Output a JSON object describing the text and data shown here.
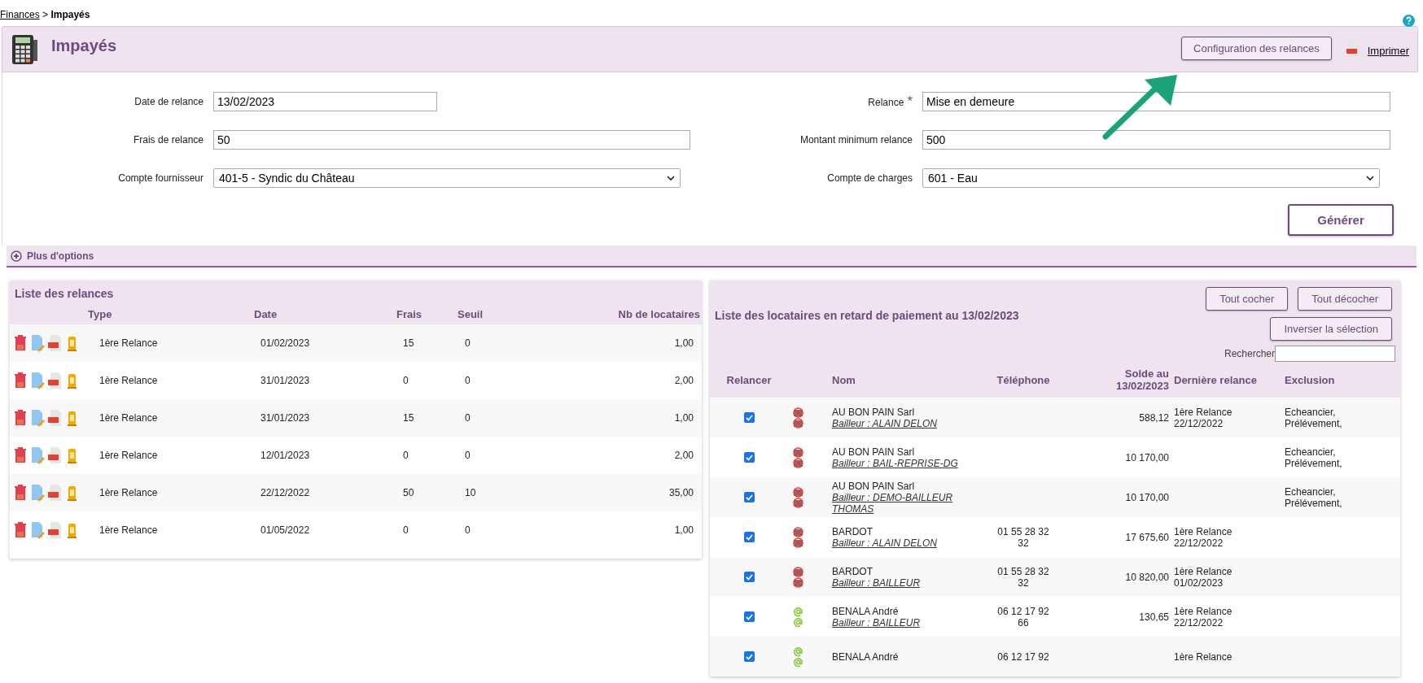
{
  "breadcrumb": {
    "parent": "Finances",
    "separator": ">",
    "current": "Impayés"
  },
  "header": {
    "title": "Impayés",
    "config_button": "Configuration des relances",
    "print_link": "Imprimer"
  },
  "form": {
    "left": [
      {
        "label": "Date de relance",
        "value": "13/02/2023",
        "kind": "text"
      },
      {
        "label": "Frais de relance",
        "value": "50",
        "kind": "text"
      },
      {
        "label": "Compte fournisseur",
        "value": "401-5 - Syndic du Château",
        "kind": "select"
      }
    ],
    "right": [
      {
        "label": "Relance",
        "required_mark": "*",
        "value": "Mise en demeure",
        "kind": "text"
      },
      {
        "label": "Montant minimum relance",
        "value": "500",
        "kind": "text"
      },
      {
        "label": "Compte de charges",
        "value": "601 - Eau",
        "kind": "select"
      }
    ],
    "generate_button": "Générer"
  },
  "options_bar": {
    "label": "Plus d'options",
    "expanded": false
  },
  "relances": {
    "title": "Liste des relances",
    "columns": [
      "Type",
      "Date",
      "Frais",
      "Seuil",
      "Nb de locataires"
    ],
    "rows": [
      {
        "type": "1ère Relance",
        "date": "01/02/2023",
        "frais": "15",
        "seuil": "0",
        "nb": "1,00"
      },
      {
        "type": "1ère Relance",
        "date": "31/01/2023",
        "frais": "0",
        "seuil": "0",
        "nb": "2,00"
      },
      {
        "type": "1ère Relance",
        "date": "31/01/2023",
        "frais": "15",
        "seuil": "0",
        "nb": "1,00"
      },
      {
        "type": "1ère Relance",
        "date": "12/01/2023",
        "frais": "0",
        "seuil": "0",
        "nb": "2,00"
      },
      {
        "type": "1ère Relance",
        "date": "22/12/2022",
        "frais": "50",
        "seuil": "10",
        "nb": "35,00"
      },
      {
        "type": "1ère Relance",
        "date": "01/05/2022",
        "frais": "0",
        "seuil": "0",
        "nb": "1,00"
      }
    ]
  },
  "locataires": {
    "title": "Liste des locataires en retard de paiement au 13/02/2023",
    "buttons": [
      "Tout cocher",
      "Tout décocher",
      "Inverser la sélection"
    ],
    "search_label": "Rechercher",
    "columns": [
      "Relancer",
      "Nom",
      "Téléphone",
      "Solde au 13/02/2023",
      "Dernière relance",
      "Exclusion"
    ],
    "rows": [
      {
        "checked": true,
        "kind": "blocked",
        "name": "AU BON PAIN Sarl",
        "owner": "Bailleur : ALAIN DELON",
        "phone": "",
        "solde": "588,12",
        "last": [
          "1ère Relance",
          "22/12/2022"
        ],
        "exclusion": [
          "Echeancier,",
          "Prélévement,"
        ]
      },
      {
        "checked": true,
        "kind": "blocked",
        "name": "AU BON PAIN Sarl",
        "owner": "Bailleur : BAIL-REPRISE-DG",
        "phone": "",
        "solde": "10 170,00",
        "last": [],
        "exclusion": [
          "Echeancier,",
          "Prélévement,"
        ]
      },
      {
        "checked": true,
        "kind": "blocked",
        "name": "AU BON PAIN Sarl",
        "owner": "Bailleur : DEMO-BAILLEUR THOMAS",
        "phone": "",
        "solde": "10 170,00",
        "last": [],
        "exclusion": [
          "Echeancier,",
          "Prélévement,"
        ]
      },
      {
        "checked": true,
        "kind": "blocked",
        "name": "BARDOT",
        "owner": "Bailleur : ALAIN DELON",
        "phone": "01 55 28 32 32",
        "solde": "17 675,60",
        "last": [
          "1ère Relance",
          "22/12/2022"
        ],
        "exclusion": []
      },
      {
        "checked": true,
        "kind": "blocked",
        "name": "BARDOT",
        "owner": "Bailleur : BAILLEUR",
        "phone": "01 55 28 32 32",
        "solde": "10 820,00",
        "last": [
          "1ère Relance",
          "01/02/2023"
        ],
        "exclusion": []
      },
      {
        "checked": true,
        "kind": "email",
        "name": "BENALA André",
        "owner": "Bailleur : BAILLEUR",
        "phone": "06 12 17 92 66",
        "solde": "130,65",
        "last": [
          "1ère Relance",
          "22/12/2022"
        ],
        "exclusion": []
      },
      {
        "checked": true,
        "kind": "email",
        "name": "BENALA André",
        "owner": "",
        "phone": "06 12 17 92",
        "solde": "",
        "last": [
          "1ère Relance"
        ],
        "exclusion": []
      }
    ]
  }
}
